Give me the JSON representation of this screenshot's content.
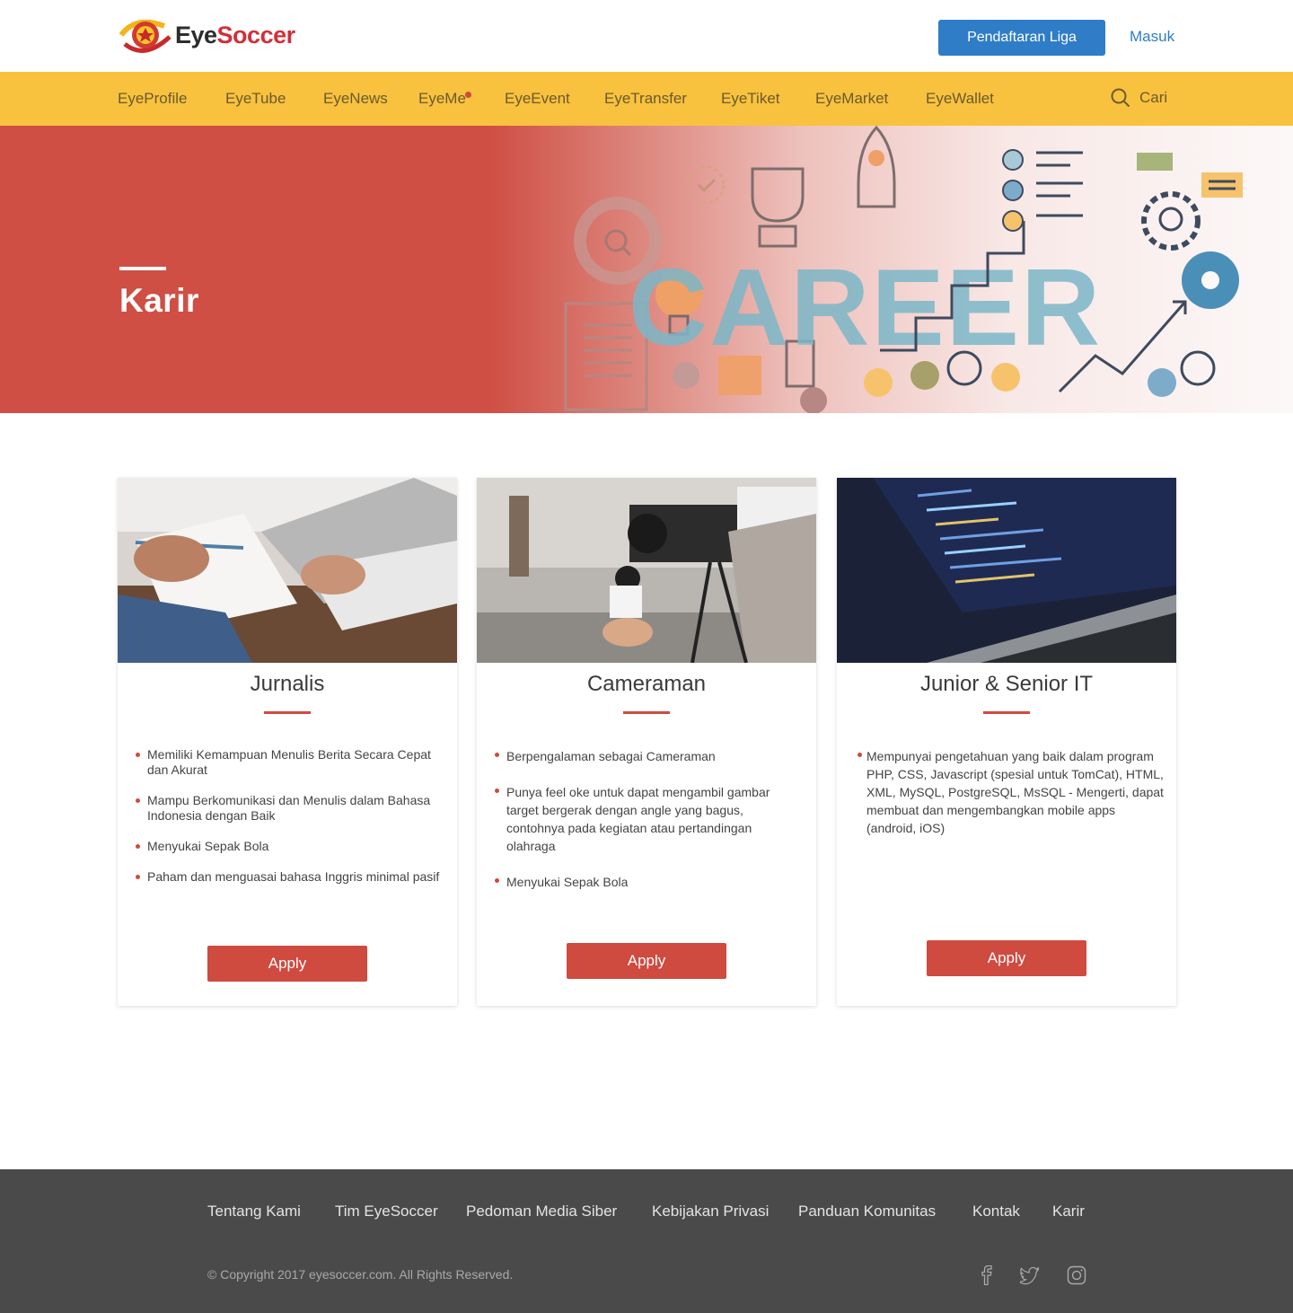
{
  "header": {
    "logo_eye": "Eye",
    "logo_soccer": "Soccer",
    "register_label": "Pendaftaran Liga",
    "login_label": "Masuk"
  },
  "nav": {
    "items": [
      "EyeProfile",
      "EyeTube",
      "EyeNews",
      "EyeMe",
      "EyeEvent",
      "EyeTransfer",
      "EyeTiket",
      "EyeMarket",
      "EyeWallet"
    ],
    "search_label": "Cari"
  },
  "hero": {
    "title": "Karir",
    "art_word": "CAREER"
  },
  "cards": [
    {
      "title": "Jurnalis",
      "requirements": [
        "Memiliki Kemampuan Menulis Berita Secara Cepat dan Akurat",
        "Mampu Berkomunikasi dan Menulis dalam Bahasa Indonesia dengan Baik",
        "Menyukai Sepak Bola",
        "Paham dan menguasai bahasa Inggris minimal pasif"
      ],
      "apply_label": "Apply"
    },
    {
      "title": "Cameraman",
      "requirements": [
        "Berpengalaman sebagai Cameraman",
        "Punya feel oke untuk dapat mengambil gambar target bergerak dengan angle yang bagus, contohnya pada kegiatan atau pertandingan olahraga",
        "Menyukai Sepak Bola"
      ],
      "apply_label": "Apply"
    },
    {
      "title": "Junior & Senior IT",
      "requirements": [
        "Mempunyai pengetahuan yang baik dalam program PHP, CSS, Javascript (spesial untuk TomCat), HTML, XML, MySQL, PostgreSQL, MsSQL - Mengerti, dapat membuat dan mengembangkan mobile apps (android, iOS)"
      ],
      "apply_label": "Apply"
    }
  ],
  "footer": {
    "links": [
      "Tentang Kami",
      "Tim EyeSoccer",
      "Pedoman Media Siber",
      "Kebijakan Privasi",
      "Panduan Komunitas",
      "Kontak",
      "Karir"
    ],
    "copyright": "© Copyright 2017 eyesoccer.com. All Rights Reserved."
  },
  "colors": {
    "brand_yellow": "#f8c23e",
    "brand_red": "#cf4a3f",
    "brand_blue": "#2f7dc6",
    "footer_bg": "#4a4a4a"
  }
}
